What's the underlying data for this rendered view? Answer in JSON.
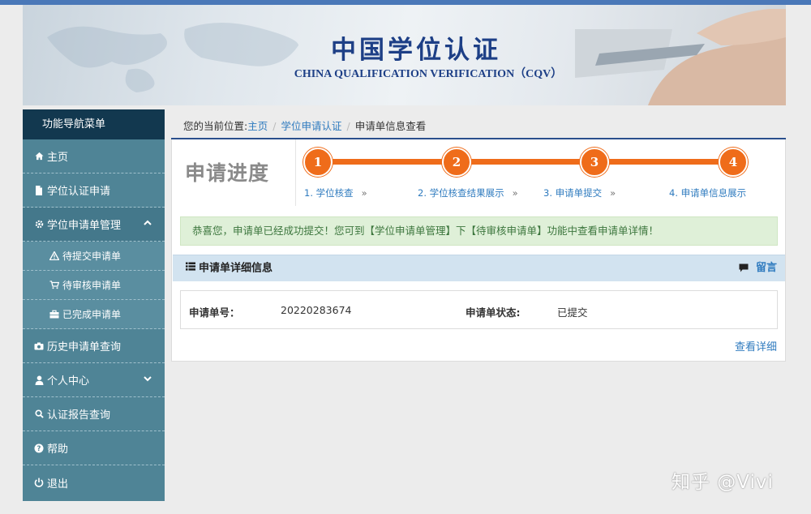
{
  "banner": {
    "title": "中国学位认证",
    "subtitle": "CHINA QUALIFICATION VERIFICATION（CQV）"
  },
  "sidebar": {
    "header": "功能导航菜单",
    "items": [
      {
        "label": "主页",
        "icon": "home-icon"
      },
      {
        "label": "学位认证申请",
        "icon": "document-icon"
      },
      {
        "label": "学位申请单管理",
        "icon": "gear-icon",
        "expanded": true,
        "children": [
          {
            "label": "待提交申请单",
            "icon": "warning-icon"
          },
          {
            "label": "待审核申请单",
            "icon": "cart-icon"
          },
          {
            "label": "已完成申请单",
            "icon": "briefcase-icon"
          }
        ]
      },
      {
        "label": "历史申请单查询",
        "icon": "camera-icon"
      },
      {
        "label": "个人中心",
        "icon": "user-icon",
        "expanded": false
      },
      {
        "label": "认证报告查询",
        "icon": "search-icon"
      },
      {
        "label": "帮助",
        "icon": "help-icon"
      },
      {
        "label": "退出",
        "icon": "power-icon"
      }
    ]
  },
  "breadcrumb": {
    "prefix": "您的当前位置:",
    "items": [
      "主页",
      "学位申请认证",
      "申请单信息查看"
    ]
  },
  "progress": {
    "title": "申请进度",
    "steps": [
      {
        "num": "1",
        "label": "1. 学位核查"
      },
      {
        "num": "2",
        "label": "2. 学位核查结果展示"
      },
      {
        "num": "3",
        "label": "3. 申请单提交"
      },
      {
        "num": "4",
        "label": "4. 申请单信息展示"
      }
    ],
    "arrow": "»"
  },
  "alert": "恭喜您，申请单已经成功提交！您可到【学位申请单管理】下【待审核申请单】功能中查看申请单详情！",
  "details": {
    "header": "申请单详细信息",
    "message_link": "留言",
    "number_label": "申请单号：",
    "number_value": "20220283674",
    "status_label": "申请单状态:",
    "status_value": "已提交",
    "view_link": "查看详细"
  },
  "watermark": "知乎 @Vivi",
  "colors": {
    "accent": "#ef6c1a",
    "sidebar": "#4f8496",
    "sidebar_head": "#12384f",
    "link": "#2f7bbf"
  }
}
